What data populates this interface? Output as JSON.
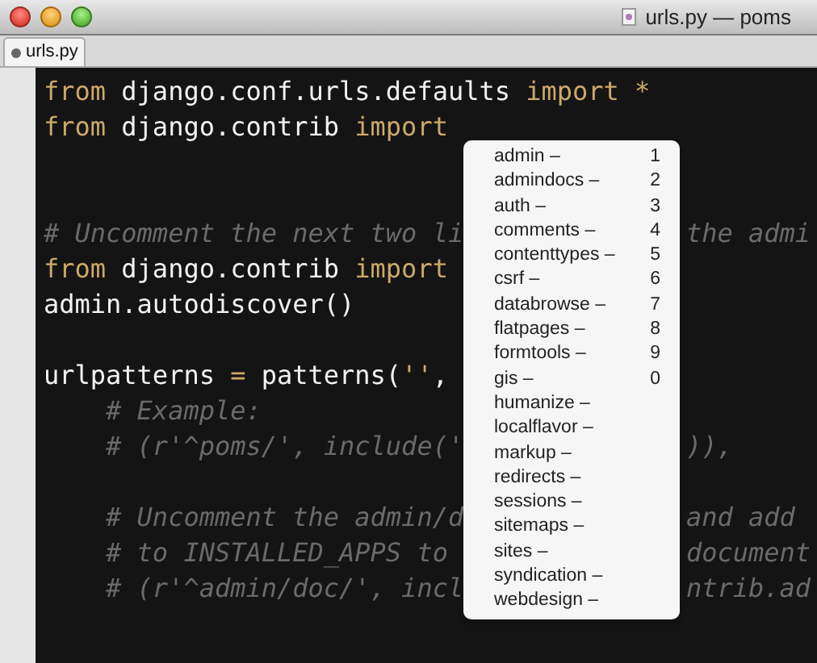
{
  "window": {
    "title": "urls.py — poms"
  },
  "tabs": [
    {
      "label": "urls.py",
      "selected": true
    }
  ],
  "code_lines": [
    {
      "kind": "code",
      "left": [
        {
          "kind": "keyword",
          "text": "from"
        },
        {
          "kind": "plain",
          "text": " django.conf.urls.defaults "
        },
        {
          "kind": "keyword",
          "text": "import *"
        }
      ]
    },
    {
      "kind": "code",
      "left": [
        {
          "kind": "keyword",
          "text": "from"
        },
        {
          "kind": "plain",
          "text": " django.contrib "
        },
        {
          "kind": "keyword",
          "text": "import"
        }
      ]
    },
    {
      "kind": "blank"
    },
    {
      "kind": "blank"
    },
    {
      "kind": "code",
      "left": [
        {
          "kind": "comment",
          "text": "# Uncomment the next two li"
        }
      ],
      "right": [
        {
          "kind": "comment",
          "text": "the admi"
        }
      ]
    },
    {
      "kind": "code",
      "left": [
        {
          "kind": "keyword",
          "text": "from"
        },
        {
          "kind": "plain",
          "text": " django.contrib "
        },
        {
          "kind": "keyword",
          "text": "import"
        }
      ]
    },
    {
      "kind": "code",
      "left": [
        {
          "kind": "plain",
          "text": "admin.autodiscover()"
        }
      ]
    },
    {
      "kind": "blank"
    },
    {
      "kind": "code",
      "left": [
        {
          "kind": "plain",
          "text": "urlpatterns "
        },
        {
          "kind": "keyword",
          "text": "="
        },
        {
          "kind": "plain",
          "text": " patterns("
        },
        {
          "kind": "keyword",
          "text": "''"
        },
        {
          "kind": "plain",
          "text": ","
        }
      ]
    },
    {
      "kind": "code",
      "left": [
        {
          "kind": "comment",
          "text": "    # Example:"
        }
      ]
    },
    {
      "kind": "code",
      "left": [
        {
          "kind": "comment",
          "text": "    # (r'^poms/', include('"
        }
      ],
      "right": [
        {
          "kind": "comment",
          "text": ")),"
        }
      ]
    },
    {
      "kind": "blank"
    },
    {
      "kind": "code",
      "left": [
        {
          "kind": "comment",
          "text": "    # Uncomment the admin/d"
        }
      ],
      "right": [
        {
          "kind": "comment",
          "text": "and add"
        }
      ]
    },
    {
      "kind": "code",
      "left": [
        {
          "kind": "comment",
          "text": "    # to INSTALLED_APPS to"
        }
      ],
      "right": [
        {
          "kind": "comment",
          "text": "document"
        }
      ]
    },
    {
      "kind": "code",
      "left": [
        {
          "kind": "comment",
          "text": "    # (r'^admin/doc/', incl"
        }
      ],
      "right": [
        {
          "kind": "comment",
          "text": "ntrib.ad"
        }
      ]
    }
  ],
  "completion_menu": {
    "items": [
      {
        "label": "admin –",
        "shortcut": "1"
      },
      {
        "label": "admindocs –",
        "shortcut": "2"
      },
      {
        "label": "auth –",
        "shortcut": "3"
      },
      {
        "label": "comments –",
        "shortcut": "4"
      },
      {
        "label": "contenttypes –",
        "shortcut": "5"
      },
      {
        "label": "csrf –",
        "shortcut": "6"
      },
      {
        "label": "databrowse –",
        "shortcut": "7"
      },
      {
        "label": "flatpages –",
        "shortcut": "8"
      },
      {
        "label": "formtools –",
        "shortcut": "9"
      },
      {
        "label": "gis –",
        "shortcut": "0"
      },
      {
        "label": "humanize –"
      },
      {
        "label": "localflavor –"
      },
      {
        "label": "markup –"
      },
      {
        "label": "redirects –"
      },
      {
        "label": "sessions –"
      },
      {
        "label": "sitemaps –"
      },
      {
        "label": "sites –"
      },
      {
        "label": "syndication –"
      },
      {
        "label": "webdesign –"
      }
    ]
  }
}
